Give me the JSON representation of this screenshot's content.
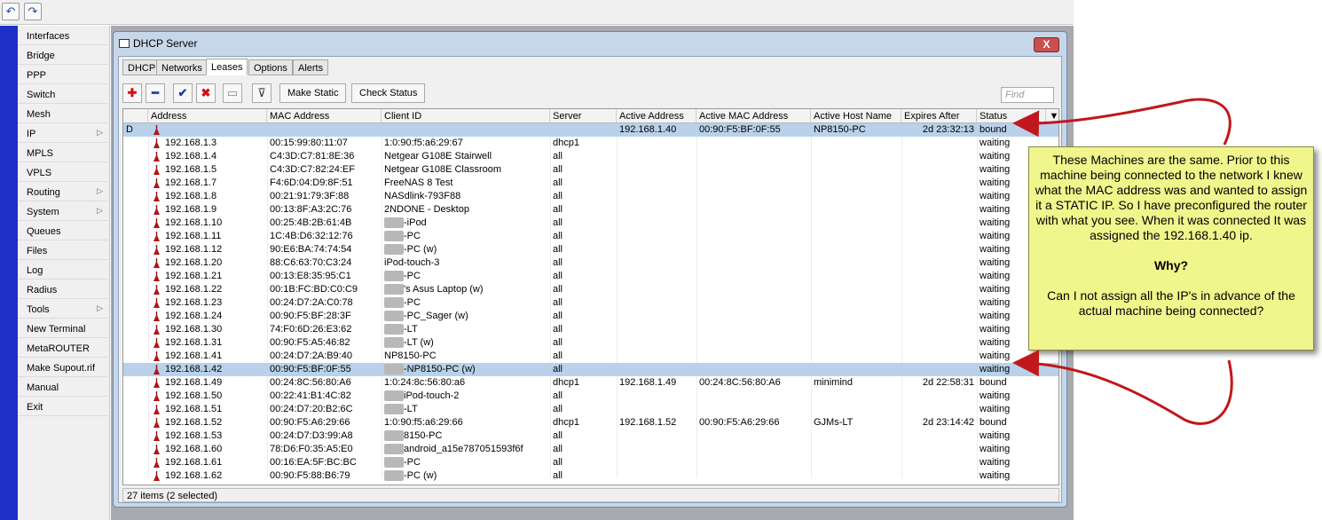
{
  "toolbar_icons": [
    "undo-icon",
    "redo-icon"
  ],
  "menu": {
    "items": [
      {
        "label": "Interfaces",
        "submenu": false
      },
      {
        "label": "Bridge",
        "submenu": false
      },
      {
        "label": "PPP",
        "submenu": false
      },
      {
        "label": "Switch",
        "submenu": false
      },
      {
        "label": "Mesh",
        "submenu": false
      },
      {
        "label": "IP",
        "submenu": true
      },
      {
        "label": "MPLS",
        "submenu": false
      },
      {
        "label": "VPLS",
        "submenu": false
      },
      {
        "label": "Routing",
        "submenu": true
      },
      {
        "label": "System",
        "submenu": true
      },
      {
        "label": "Queues",
        "submenu": false
      },
      {
        "label": "Files",
        "submenu": false
      },
      {
        "label": "Log",
        "submenu": false
      },
      {
        "label": "Radius",
        "submenu": false
      },
      {
        "label": "Tools",
        "submenu": true
      },
      {
        "label": "New Terminal",
        "submenu": false
      },
      {
        "label": "MetaROUTER",
        "submenu": false
      },
      {
        "label": "Make Supout.rif",
        "submenu": false
      },
      {
        "label": "Manual",
        "submenu": false
      },
      {
        "label": "Exit",
        "submenu": false
      }
    ]
  },
  "window": {
    "title": "DHCP Server",
    "close_label": "X",
    "tabs": [
      "DHCP",
      "Networks",
      "Leases",
      "Options",
      "Alerts"
    ],
    "active_tab": "Leases",
    "toolbar": {
      "make_static": "Make Static",
      "check_status": "Check Status",
      "find_placeholder": "Find"
    },
    "columns": [
      "",
      "Address",
      "MAC Address",
      "Client ID",
      "Server",
      "Active Address",
      "Active MAC Address",
      "Active Host Name",
      "Expires After",
      "Status"
    ],
    "rows": [
      {
        "flag": "D",
        "address": "",
        "mac": "",
        "client": "",
        "server": "",
        "act_addr": "192.168.1.40",
        "act_mac": "00:90:F5:BF:0F:55",
        "host": "NP8150-PC",
        "expires": "2d 23:32:13",
        "status": "bound",
        "selected": true
      },
      {
        "flag": "",
        "address": "192.168.1.3",
        "mac": "00:15:99:80:11:07",
        "client": "1:0:90:f5:a6:29:67",
        "server": "dhcp1",
        "act_addr": "",
        "act_mac": "",
        "host": "",
        "expires": "",
        "status": "waiting"
      },
      {
        "flag": "",
        "address": "192.168.1.4",
        "mac": "C4:3D:C7:81:8E:36",
        "client": "Netgear G108E Stairwell",
        "server": "all",
        "act_addr": "",
        "act_mac": "",
        "host": "",
        "expires": "",
        "status": "waiting"
      },
      {
        "flag": "",
        "address": "192.168.1.5",
        "mac": "C4:3D:C7:82:24:EF",
        "client": "Netgear G108E Classroom",
        "server": "all",
        "act_addr": "",
        "act_mac": "",
        "host": "",
        "expires": "",
        "status": "waiting"
      },
      {
        "flag": "",
        "address": "192.168.1.7",
        "mac": "F4:6D:04:D9:8F:51",
        "client": "FreeNAS 8 Test",
        "server": "all",
        "act_addr": "",
        "act_mac": "",
        "host": "",
        "expires": "",
        "status": "waiting"
      },
      {
        "flag": "",
        "address": "192.168.1.8",
        "mac": "00:21:91:79:3F:88",
        "client": "NASdlink-793F88",
        "server": "all",
        "act_addr": "",
        "act_mac": "",
        "host": "",
        "expires": "",
        "status": "waiting"
      },
      {
        "flag": "",
        "address": "192.168.1.9",
        "mac": "00:13:8F:A3:2C:76",
        "client": "2NDONE - Desktop",
        "server": "all",
        "act_addr": "",
        "act_mac": "",
        "host": "",
        "expires": "",
        "status": "waiting"
      },
      {
        "flag": "",
        "address": "192.168.1.10",
        "mac": "00:25:4B:2B:61:4B",
        "client": "-iPod",
        "blur": true,
        "server": "all",
        "act_addr": "",
        "act_mac": "",
        "host": "",
        "expires": "",
        "status": "waiting"
      },
      {
        "flag": "",
        "address": "192.168.1.11",
        "mac": "1C:4B:D6:32:12:76",
        "client": "-PC",
        "blur": true,
        "server": "all",
        "act_addr": "",
        "act_mac": "",
        "host": "",
        "expires": "",
        "status": "waiting"
      },
      {
        "flag": "",
        "address": "192.168.1.12",
        "mac": "90:E6:BA:74:74:54",
        "client": "-PC (w)",
        "blur": true,
        "server": "all",
        "act_addr": "",
        "act_mac": "",
        "host": "",
        "expires": "",
        "status": "waiting"
      },
      {
        "flag": "",
        "address": "192.168.1.20",
        "mac": "88:C6:63:70:C3:24",
        "client": "iPod-touch-3",
        "server": "all",
        "act_addr": "",
        "act_mac": "",
        "host": "",
        "expires": "",
        "status": "waiting"
      },
      {
        "flag": "",
        "address": "192.168.1.21",
        "mac": "00:13:E8:35:95:C1",
        "client": "-PC",
        "blur": true,
        "server": "all",
        "act_addr": "",
        "act_mac": "",
        "host": "",
        "expires": "",
        "status": "waiting"
      },
      {
        "flag": "",
        "address": "192.168.1.22",
        "mac": "00:1B:FC:BD:C0:C9",
        "client": "'s Asus Laptop (w)",
        "blur": true,
        "server": "all",
        "act_addr": "",
        "act_mac": "",
        "host": "",
        "expires": "",
        "status": "waiting"
      },
      {
        "flag": "",
        "address": "192.168.1.23",
        "mac": "00:24:D7:2A:C0:78",
        "client": "-PC",
        "blur": true,
        "server": "all",
        "act_addr": "",
        "act_mac": "",
        "host": "",
        "expires": "",
        "status": "waiting"
      },
      {
        "flag": "",
        "address": "192.168.1.24",
        "mac": "00:90:F5:BF:28:3F",
        "client": "-PC_Sager (w)",
        "blur": true,
        "server": "all",
        "act_addr": "",
        "act_mac": "",
        "host": "",
        "expires": "",
        "status": "waiting"
      },
      {
        "flag": "",
        "address": "192.168.1.30",
        "mac": "74:F0:6D:26:E3:62",
        "client": "-LT",
        "blur": true,
        "server": "all",
        "act_addr": "",
        "act_mac": "",
        "host": "",
        "expires": "",
        "status": "waiting"
      },
      {
        "flag": "",
        "address": "192.168.1.31",
        "mac": "00:90:F5:A5:46:82",
        "client": "-LT (w)",
        "blur": true,
        "server": "all",
        "act_addr": "",
        "act_mac": "",
        "host": "",
        "expires": "",
        "status": "waiting"
      },
      {
        "flag": "",
        "address": "192.168.1.41",
        "mac": "00:24:D7:2A:B9:40",
        "client": "NP8150-PC",
        "server": "all",
        "act_addr": "",
        "act_mac": "",
        "host": "",
        "expires": "",
        "status": "waiting"
      },
      {
        "flag": "",
        "address": "192.168.1.42",
        "mac": "00:90:F5:BF:0F:55",
        "client": "-NP8150-PC (w)",
        "blur": true,
        "server": "all",
        "act_addr": "",
        "act_mac": "",
        "host": "",
        "expires": "",
        "status": "waiting",
        "selected": true
      },
      {
        "flag": "",
        "address": "192.168.1.49",
        "mac": "00:24:8C:56:80:A6",
        "client": "1:0:24:8c:56:80:a6",
        "server": "dhcp1",
        "act_addr": "192.168.1.49",
        "act_mac": "00:24:8C:56:80:A6",
        "host": "minimind",
        "expires": "2d 22:58:31",
        "status": "bound"
      },
      {
        "flag": "",
        "address": "192.168.1.50",
        "mac": "00:22:41:B1:4C:82",
        "client": "iPod-touch-2",
        "blur": true,
        "server": "all",
        "act_addr": "",
        "act_mac": "",
        "host": "",
        "expires": "",
        "status": "waiting"
      },
      {
        "flag": "",
        "address": "192.168.1.51",
        "mac": "00:24:D7:20:B2:6C",
        "client": "-LT",
        "blur": true,
        "server": "all",
        "act_addr": "",
        "act_mac": "",
        "host": "",
        "expires": "",
        "status": "waiting"
      },
      {
        "flag": "",
        "address": "192.168.1.52",
        "mac": "00:90:F5:A6:29:66",
        "client": "1:0:90:f5:a6:29:66",
        "server": "dhcp1",
        "act_addr": "192.168.1.52",
        "act_mac": "00:90:F5:A6:29:66",
        "host": "GJMs-LT",
        "expires": "2d 23:14:42",
        "status": "bound"
      },
      {
        "flag": "",
        "address": "192.168.1.53",
        "mac": "00:24:D7:D3:99:A8",
        "client": "8150-PC",
        "blur": true,
        "server": "all",
        "act_addr": "",
        "act_mac": "",
        "host": "",
        "expires": "",
        "status": "waiting"
      },
      {
        "flag": "",
        "address": "192.168.1.60",
        "mac": "78:D6:F0:35:A5:E0",
        "client": "android_a15e787051593f6f",
        "blur": true,
        "server": "all",
        "act_addr": "",
        "act_mac": "",
        "host": "",
        "expires": "",
        "status": "waiting"
      },
      {
        "flag": "",
        "address": "192.168.1.61",
        "mac": "00:16:EA:5F:BC:BC",
        "client": "-PC",
        "blur": true,
        "server": "all",
        "act_addr": "",
        "act_mac": "",
        "host": "",
        "expires": "",
        "status": "waiting"
      },
      {
        "flag": "",
        "address": "192.168.1.62",
        "mac": "00:90:F5:88:B6:79",
        "client": "-PC (w)",
        "blur": true,
        "server": "all",
        "act_addr": "",
        "act_mac": "",
        "host": "",
        "expires": "",
        "status": "waiting"
      }
    ],
    "footer": "27 items (2 selected)"
  },
  "callout": {
    "paragraph1": "These Machines are the same.  Prior to this machine being connected to the network I knew what the MAC address was and wanted to assign it a STATIC IP.  So I have preconfigured the router with what you see.  When it was connected It was assigned the 192.168.1.40 ip.",
    "heading": "Why?",
    "paragraph2": "Can I not assign all the IP's in advance of the actual machine being connected?",
    "arrow_color": "#c0181c",
    "background": "#f0f58c"
  }
}
